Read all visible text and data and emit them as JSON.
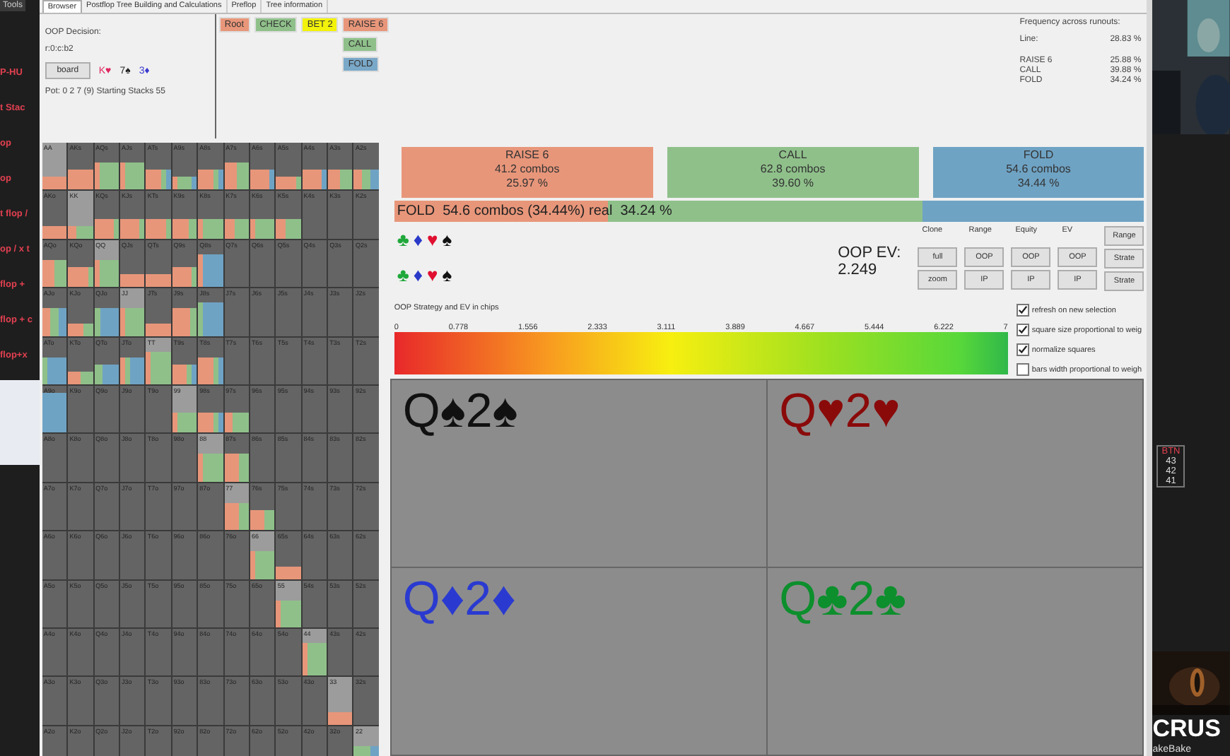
{
  "background_left": {
    "tab": "Tools",
    "labels": [
      "P-HU",
      "t Stac",
      "op",
      "op",
      "t flop /",
      "op / x t",
      "flop +",
      "flop + c",
      "flop+x"
    ]
  },
  "tabs": [
    {
      "label": "Browser",
      "selected": true
    },
    {
      "label": "Postflop Tree Building and Calculations",
      "selected": false
    },
    {
      "label": "Preflop",
      "selected": false
    },
    {
      "label": "Tree information",
      "selected": false
    }
  ],
  "decision": {
    "title": "OOP Decision:",
    "line": "r:0:c:b2",
    "board_button": "board",
    "cards": [
      {
        "text": "K♥",
        "color": "#e0245e"
      },
      {
        "text": "7♠",
        "color": "#222222"
      },
      {
        "text": "3♦",
        "color": "#3a3ad0"
      }
    ],
    "pot": "Pot: 0 2 7 (9) Starting Stacks 55"
  },
  "tree": {
    "path": [
      {
        "label": "Root",
        "color": "#e8967a"
      },
      {
        "label": "CHECK",
        "color": "#8fc08a"
      },
      {
        "label": "BET 2",
        "color": "#f2f20a"
      },
      {
        "label": "RAISE 6",
        "color": "#e8967a"
      }
    ],
    "responses": [
      {
        "label": "CALL",
        "color": "#8fc08a"
      },
      {
        "label": "FOLD",
        "color": "#7aa8c8"
      }
    ]
  },
  "frequency": {
    "title": "Frequency across runouts:",
    "rows": [
      {
        "label": "Line:",
        "value": "28.83 %"
      },
      {
        "label": "RAISE 6",
        "value": "25.88 %"
      },
      {
        "label": "CALL",
        "value": "39.88 %"
      },
      {
        "label": "FOLD",
        "value": "34.24 %"
      }
    ]
  },
  "actions": [
    {
      "kind": "raise",
      "name": "RAISE 6",
      "combos": "41.2 combos",
      "percent": "25.97 %"
    },
    {
      "kind": "call",
      "name": "CALL",
      "combos": "62.8 combos",
      "percent": "39.60 %"
    },
    {
      "kind": "fold",
      "name": "FOLD",
      "combos": "54.6 combos",
      "percent": "34.44 %"
    }
  ],
  "summary_bar": {
    "text": "FOLD  54.6 combos (34.44%) real  34.24 %"
  },
  "suit_filters": [
    [
      {
        "symbol": "♣",
        "color": "#1fa83a"
      },
      {
        "symbol": "♦",
        "color": "#2a3ac8"
      },
      {
        "symbol": "♥",
        "color": "#e01030"
      },
      {
        "symbol": "♠",
        "color": "#111111"
      }
    ],
    [
      {
        "symbol": "♣",
        "color": "#1fa83a"
      },
      {
        "symbol": "♦",
        "color": "#2a3ac8"
      },
      {
        "symbol": "♥",
        "color": "#e01030"
      },
      {
        "symbol": "♠",
        "color": "#111111"
      }
    ]
  ],
  "ev": {
    "label": "OOP EV:",
    "value": "2.249"
  },
  "button_columns": [
    {
      "header": "Clone",
      "buttons": [
        "full",
        "zoom"
      ]
    },
    {
      "header": "Range",
      "buttons": [
        "OOP",
        "IP"
      ]
    },
    {
      "header": "Equity",
      "buttons": [
        "OOP",
        "IP"
      ]
    },
    {
      "header": "EV",
      "buttons": [
        "OOP",
        "IP"
      ]
    },
    {
      "header_button": "Range",
      "buttons": [
        "Strate",
        "Strate"
      ]
    }
  ],
  "scale": {
    "title": "OOP Strategy and EV in chips",
    "ticks": [
      "0",
      "0.778",
      "1.556",
      "2.333",
      "3.111",
      "3.889",
      "4.667",
      "5.444",
      "6.222",
      "7"
    ]
  },
  "options": [
    {
      "label": "refresh on new selection",
      "checked": true
    },
    {
      "label": "square size proportional to weig",
      "checked": true
    },
    {
      "label": "normalize squares",
      "checked": true
    },
    {
      "label": "bars width proportional to weigh",
      "checked": false
    }
  ],
  "runouts": [
    {
      "text": "Q♠2♠",
      "color": "#111111"
    },
    {
      "text": "Q♥2♥",
      "color": "#8a0a0a"
    },
    {
      "text": "Q♦2♦",
      "color": "#2a3ad0"
    },
    {
      "text": "Q♣2♣",
      "color": "#0c8f2c"
    }
  ],
  "matrix": {
    "rows": [
      [
        {
          "hand": "AA"
        },
        {
          "hand": "AKs"
        },
        {
          "hand": "AQs"
        },
        {
          "hand": "AJs"
        },
        {
          "hand": "ATs"
        },
        {
          "hand": "A9s"
        },
        {
          "hand": "A8s"
        },
        {
          "hand": "A7s"
        },
        {
          "hand": "A6s"
        },
        {
          "hand": "A5s"
        },
        {
          "hand": "A4s"
        },
        {
          "hand": "A3s"
        },
        {
          "hand": "A2s"
        }
      ],
      [
        {
          "hand": "AKo"
        },
        {
          "hand": "KK"
        },
        {
          "hand": "KQs"
        },
        {
          "hand": "KJs"
        },
        {
          "hand": "KTs"
        },
        {
          "hand": "K9s"
        },
        {
          "hand": "K8s"
        },
        {
          "hand": "K7s"
        },
        {
          "hand": "K6s"
        },
        {
          "hand": "K5s"
        },
        {
          "hand": "K4s"
        },
        {
          "hand": "K3s"
        },
        {
          "hand": "K2s"
        }
      ],
      [
        {
          "hand": "AQo"
        },
        {
          "hand": "KQo"
        },
        {
          "hand": "QQ"
        },
        {
          "hand": "QJs"
        },
        {
          "hand": "QTs"
        },
        {
          "hand": "Q9s"
        },
        {
          "hand": "Q8s"
        },
        {
          "hand": "Q7s"
        },
        {
          "hand": "Q6s"
        },
        {
          "hand": "Q5s"
        },
        {
          "hand": "Q4s"
        },
        {
          "hand": "Q3s"
        },
        {
          "hand": "Q2s"
        }
      ],
      [
        {
          "hand": "AJo"
        },
        {
          "hand": "KJo"
        },
        {
          "hand": "QJo"
        },
        {
          "hand": "JJ"
        },
        {
          "hand": "JTs"
        },
        {
          "hand": "J9s"
        },
        {
          "hand": "J8s"
        },
        {
          "hand": "J7s"
        },
        {
          "hand": "J6s"
        },
        {
          "hand": "J5s"
        },
        {
          "hand": "J4s"
        },
        {
          "hand": "J3s"
        },
        {
          "hand": "J2s"
        }
      ],
      [
        {
          "hand": "ATo"
        },
        {
          "hand": "KTo"
        },
        {
          "hand": "QTo"
        },
        {
          "hand": "JTo"
        },
        {
          "hand": "TT"
        },
        {
          "hand": "T9s"
        },
        {
          "hand": "T8s"
        },
        {
          "hand": "T7s"
        },
        {
          "hand": "T6s"
        },
        {
          "hand": "T5s"
        },
        {
          "hand": "T4s"
        },
        {
          "hand": "T3s"
        },
        {
          "hand": "T2s"
        }
      ],
      [
        {
          "hand": "A9o"
        },
        {
          "hand": "K9o"
        },
        {
          "hand": "Q9o"
        },
        {
          "hand": "J9o"
        },
        {
          "hand": "T9o"
        },
        {
          "hand": "99"
        },
        {
          "hand": "98s"
        },
        {
          "hand": "97s"
        },
        {
          "hand": "96s"
        },
        {
          "hand": "95s"
        },
        {
          "hand": "94s"
        },
        {
          "hand": "93s"
        },
        {
          "hand": "92s"
        }
      ],
      [
        {
          "hand": "A8o"
        },
        {
          "hand": "K8o"
        },
        {
          "hand": "Q8o"
        },
        {
          "hand": "J8o"
        },
        {
          "hand": "T8o"
        },
        {
          "hand": "98o"
        },
        {
          "hand": "88"
        },
        {
          "hand": "87s"
        },
        {
          "hand": "86s"
        },
        {
          "hand": "85s"
        },
        {
          "hand": "84s"
        },
        {
          "hand": "83s"
        },
        {
          "hand": "82s"
        }
      ],
      [
        {
          "hand": "A7o"
        },
        {
          "hand": "K7o"
        },
        {
          "hand": "Q7o"
        },
        {
          "hand": "J7o"
        },
        {
          "hand": "T7o"
        },
        {
          "hand": "97o"
        },
        {
          "hand": "87o"
        },
        {
          "hand": "77"
        },
        {
          "hand": "76s"
        },
        {
          "hand": "75s"
        },
        {
          "hand": "74s"
        },
        {
          "hand": "73s"
        },
        {
          "hand": "72s"
        }
      ],
      [
        {
          "hand": "A6o"
        },
        {
          "hand": "K6o"
        },
        {
          "hand": "Q6o"
        },
        {
          "hand": "J6o"
        },
        {
          "hand": "T6o"
        },
        {
          "hand": "96o"
        },
        {
          "hand": "86o"
        },
        {
          "hand": "76o"
        },
        {
          "hand": "66"
        },
        {
          "hand": "65s"
        },
        {
          "hand": "64s"
        },
        {
          "hand": "63s"
        },
        {
          "hand": "62s"
        }
      ],
      [
        {
          "hand": "A5o"
        },
        {
          "hand": "K5o"
        },
        {
          "hand": "Q5o"
        },
        {
          "hand": "J5o"
        },
        {
          "hand": "T5o"
        },
        {
          "hand": "95o"
        },
        {
          "hand": "85o"
        },
        {
          "hand": "75o"
        },
        {
          "hand": "65o"
        },
        {
          "hand": "55"
        },
        {
          "hand": "54s"
        },
        {
          "hand": "53s"
        },
        {
          "hand": "52s"
        }
      ],
      [
        {
          "hand": "A4o"
        },
        {
          "hand": "K4o"
        },
        {
          "hand": "Q4o"
        },
        {
          "hand": "J4o"
        },
        {
          "hand": "T4o"
        },
        {
          "hand": "94o"
        },
        {
          "hand": "84o"
        },
        {
          "hand": "74o"
        },
        {
          "hand": "64o"
        },
        {
          "hand": "54o"
        },
        {
          "hand": "44"
        },
        {
          "hand": "43s"
        },
        {
          "hand": "42s"
        }
      ],
      [
        {
          "hand": "A3o"
        },
        {
          "hand": "K3o"
        },
        {
          "hand": "Q3o"
        },
        {
          "hand": "J3o"
        },
        {
          "hand": "T3o"
        },
        {
          "hand": "93o"
        },
        {
          "hand": "83o"
        },
        {
          "hand": "73o"
        },
        {
          "hand": "63o"
        },
        {
          "hand": "53o"
        },
        {
          "hand": "43o"
        },
        {
          "hand": "33"
        },
        {
          "hand": "32s"
        }
      ],
      [
        {
          "hand": "A2o"
        },
        {
          "hand": "K2o"
        },
        {
          "hand": "Q2o"
        },
        {
          "hand": "J2o"
        },
        {
          "hand": "T2o"
        },
        {
          "hand": "92o"
        },
        {
          "hand": "82o"
        },
        {
          "hand": "72o"
        },
        {
          "hand": "62o"
        },
        {
          "hand": "52o"
        },
        {
          "hand": "42o"
        },
        {
          "hand": "32o"
        },
        {
          "hand": "22"
        }
      ]
    ]
  },
  "side_panel": {
    "seat": "BTN",
    "stacks": [
      "43",
      "42",
      "41"
    ],
    "banner": "CRUS",
    "caption": "akeBake"
  }
}
